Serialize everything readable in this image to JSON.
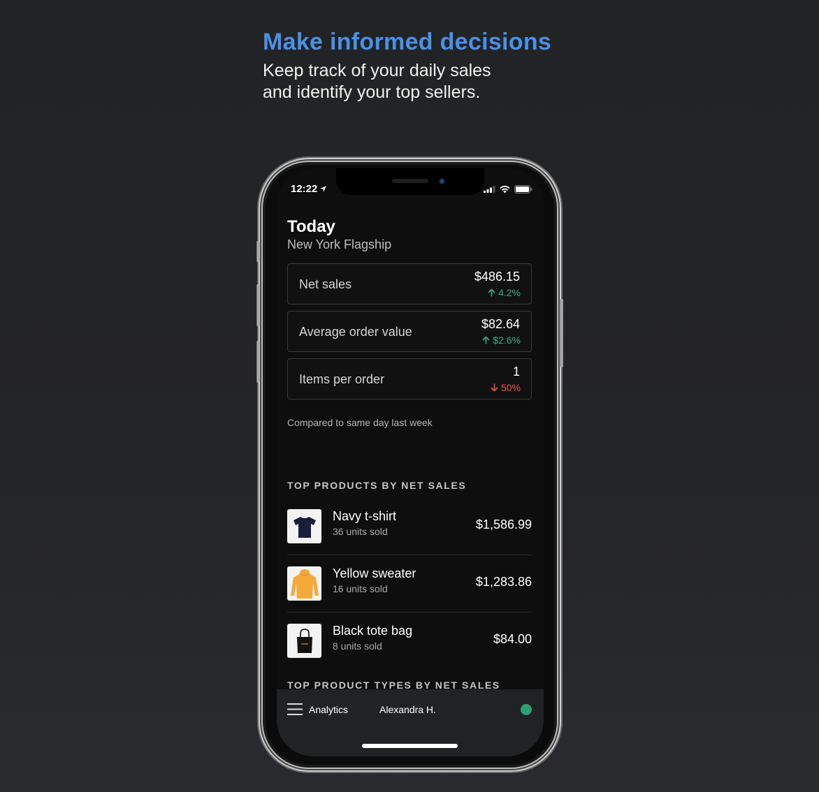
{
  "hero": {
    "title": "Make informed decisions",
    "subtitle_line1": "Keep track of your daily sales",
    "subtitle_line2": "and identify your top sellers."
  },
  "status_bar": {
    "time": "12:22",
    "location_icon": "location-arrow-icon",
    "signal_icon": "cellular-signal-icon",
    "wifi_icon": "wifi-icon",
    "battery_icon": "battery-icon"
  },
  "header": {
    "title": "Today",
    "location": "New York Flagship"
  },
  "metrics": [
    {
      "label": "Net sales",
      "value": "$486.15",
      "change": "4.2%",
      "direction": "up"
    },
    {
      "label": "Average order value",
      "value": "$82.64",
      "change": "$2.6%",
      "direction": "up"
    },
    {
      "label": "Items per order",
      "value": "1",
      "change": "50%",
      "direction": "down"
    }
  ],
  "comparison_note": "Compared to same day last week",
  "top_products": {
    "heading": "TOP PRODUCTS BY NET SALES",
    "items": [
      {
        "name": "Navy t-shirt",
        "units": "36 units sold",
        "price": "$1,586.99",
        "thumb": "navy-tshirt-image"
      },
      {
        "name": "Yellow sweater",
        "units": "16 units sold",
        "price": "$1,283.86",
        "thumb": "yellow-hoodie-image"
      },
      {
        "name": "Black tote bag",
        "units": "8 units sold",
        "price": "$84.00",
        "thumb": "black-tote-image"
      }
    ]
  },
  "top_product_types": {
    "heading": "TOP PRODUCT TYPES BY NET SALES"
  },
  "bottom_bar": {
    "menu_label": "Analytics",
    "user_name": "Alexandra H.",
    "status_color": "#2e9e75"
  },
  "colors": {
    "accent": "#4a90e8",
    "positive": "#2fb381",
    "negative": "#ec5450"
  }
}
